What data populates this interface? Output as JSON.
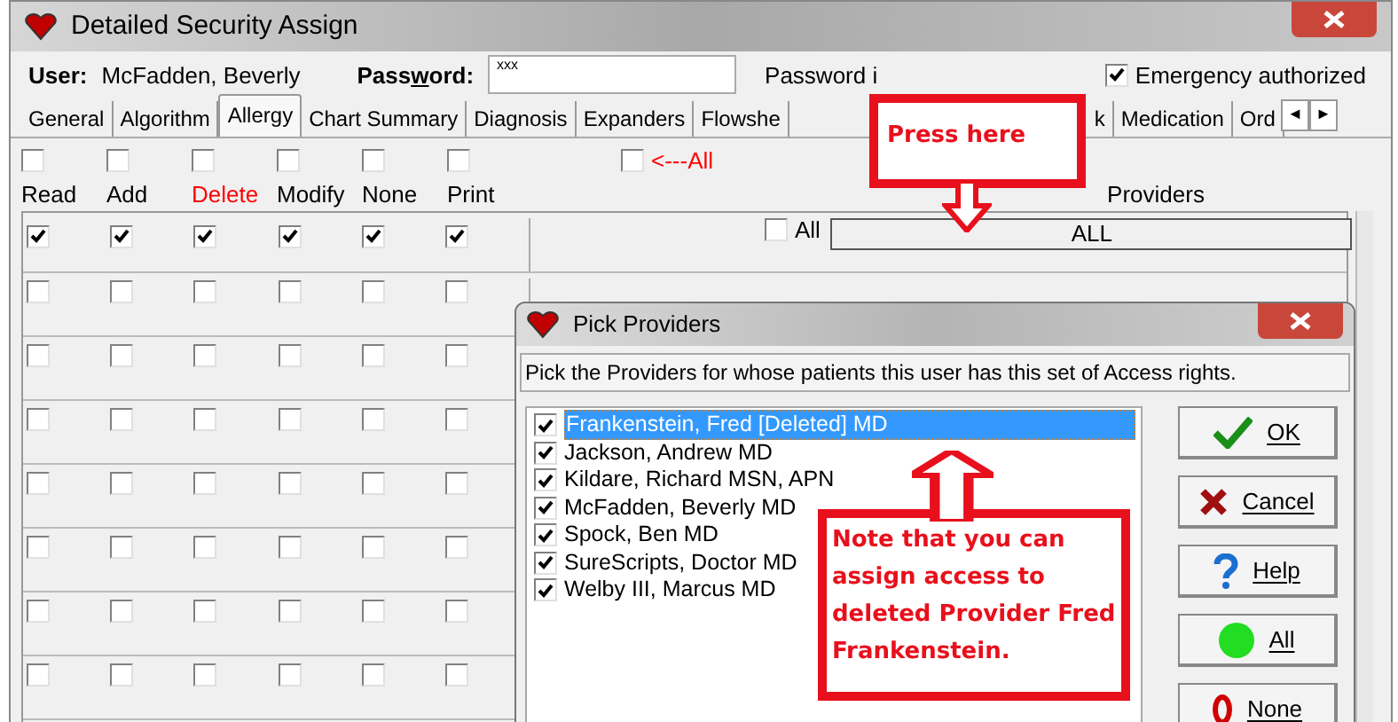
{
  "window": {
    "title": "Detailed Security Assign"
  },
  "user": {
    "label": "User:",
    "value": "McFadden, Beverly"
  },
  "password": {
    "label": "Pass",
    "label_underlined": "w",
    "label_rest": "ord:",
    "value": "xxx",
    "note": "Password i"
  },
  "emergency": {
    "label": "Emergency authorized",
    "checked": true
  },
  "tabs": [
    {
      "label": "General",
      "selected": false
    },
    {
      "label": "Algorithm",
      "selected": false
    },
    {
      "label": "Allergy",
      "selected": true
    },
    {
      "label": "Chart Summary",
      "selected": false
    },
    {
      "label": "Diagnosis",
      "selected": false
    },
    {
      "label": "Expanders",
      "selected": false
    },
    {
      "label": "Flowshe",
      "selected": false
    },
    {
      "label": "k",
      "selected": false
    },
    {
      "label": "Medication",
      "selected": false
    },
    {
      "label": "Ord",
      "selected": false
    }
  ],
  "tab_scroll": {
    "left": "◄",
    "right": "►"
  },
  "columns": [
    {
      "label": "Read",
      "checked": false,
      "color": "#000000"
    },
    {
      "label": "Add",
      "checked": false,
      "color": "#000000"
    },
    {
      "label": "Delete",
      "checked": false,
      "color": "#ff0000"
    },
    {
      "label": "Modify",
      "checked": false,
      "color": "#000000"
    },
    {
      "label": "None",
      "checked": false,
      "color": "#000000"
    },
    {
      "label": "Print",
      "checked": false,
      "color": "#000000"
    }
  ],
  "all_columns": {
    "label": "<---All",
    "checked": false
  },
  "providers_heading": "Providers",
  "rows": [
    {
      "checks": [
        true,
        true,
        true,
        true,
        true,
        true
      ],
      "all": {
        "label": "All",
        "checked": false
      },
      "providers_button": "ALL"
    },
    {
      "checks": [
        false,
        false,
        false,
        false,
        false,
        false
      ]
    },
    {
      "checks": [
        false,
        false,
        false,
        false,
        false,
        false
      ]
    },
    {
      "checks": [
        false,
        false,
        false,
        false,
        false,
        false
      ]
    },
    {
      "checks": [
        false,
        false,
        false,
        false,
        false,
        false
      ]
    },
    {
      "checks": [
        false,
        false,
        false,
        false,
        false,
        false
      ]
    },
    {
      "checks": [
        false,
        false,
        false,
        false,
        false,
        false
      ]
    },
    {
      "checks": [
        false,
        false,
        false,
        false,
        false,
        false
      ]
    }
  ],
  "dialog": {
    "title": "Pick Providers",
    "instruction": "Pick the Providers for whose patients this user has this set of Access rights.",
    "providers": [
      {
        "name": "Frankenstein, Fred [Deleted] MD",
        "checked": true,
        "selected": true
      },
      {
        "name": "Jackson, Andrew MD",
        "checked": true,
        "selected": false
      },
      {
        "name": "Kildare, Richard MSN, APN",
        "checked": true,
        "selected": false
      },
      {
        "name": "McFadden, Beverly MD",
        "checked": true,
        "selected": false
      },
      {
        "name": "Spock, Ben MD",
        "checked": true,
        "selected": false
      },
      {
        "name": "SureScripts, Doctor MD",
        "checked": true,
        "selected": false
      },
      {
        "name": "Welby III, Marcus MD",
        "checked": true,
        "selected": false
      }
    ],
    "buttons": [
      {
        "kind": "ok",
        "label": "OK"
      },
      {
        "kind": "cancel",
        "label": "Cancel"
      },
      {
        "kind": "help",
        "label": "Help"
      },
      {
        "kind": "all",
        "label": "All"
      },
      {
        "kind": "none",
        "label": "None"
      }
    ]
  },
  "callouts": [
    {
      "kind": "down",
      "text": "Press here"
    },
    {
      "kind": "up",
      "text": "Note that you can assign access to deleted Provider Fred Frankenstein."
    }
  ]
}
